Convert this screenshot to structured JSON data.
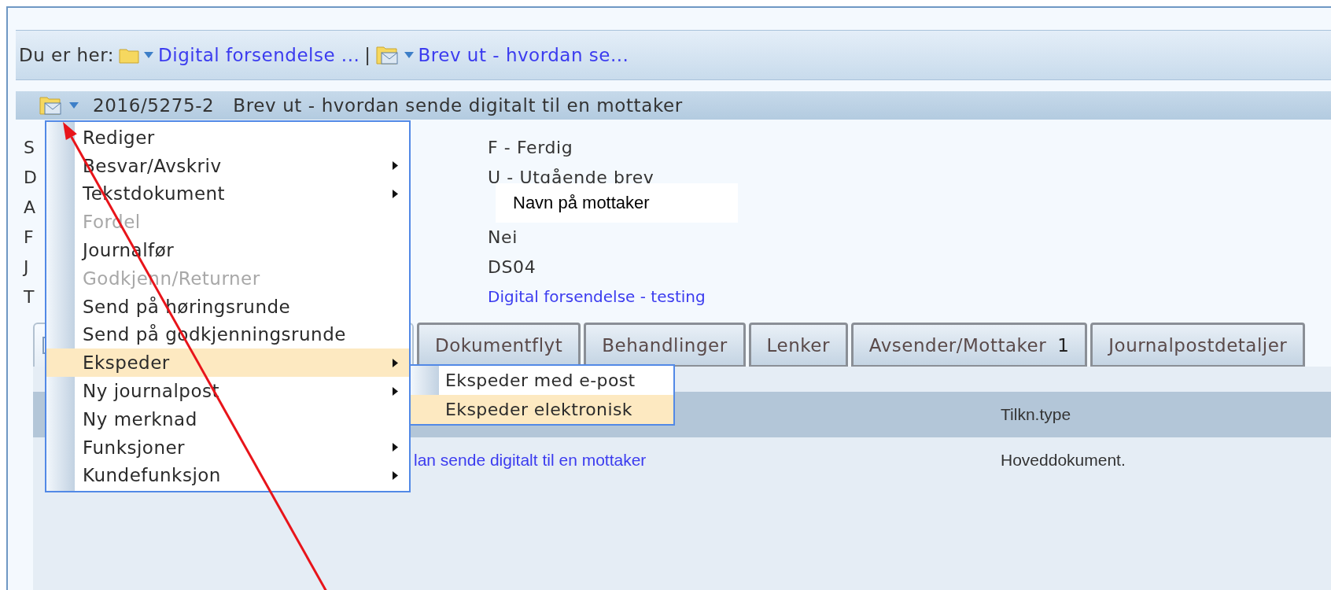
{
  "breadcrumb": {
    "label": "Du er her:",
    "separator": "|",
    "items": [
      {
        "text": "Digital forsendelse ..."
      },
      {
        "text": "Brev ut - hvordan se..."
      }
    ]
  },
  "header": {
    "number": "2016/5275-2",
    "title": "Brev ut - hvordan sende digitalt til en mottaker"
  },
  "fields": [
    {
      "label": "S",
      "value": "F - Ferdig",
      "kind": "text"
    },
    {
      "label": "D",
      "value": "U - Utgående brev",
      "kind": "text"
    },
    {
      "label": "A",
      "value": "Navn på mottaker",
      "kind": "note"
    },
    {
      "label": "F",
      "value": "Nei",
      "kind": "text"
    },
    {
      "label": "J",
      "value": "DS04",
      "kind": "text"
    },
    {
      "label": "T",
      "value": "Digital forsendelse - testing",
      "kind": "link"
    }
  ],
  "tabs": [
    {
      "label": "Dokumentflyt",
      "selected": false
    },
    {
      "label": "Behandlinger",
      "selected": false
    },
    {
      "label": "Lenker",
      "selected": false
    },
    {
      "label": "Avsender/Mottaker",
      "count": "1",
      "selected": false
    },
    {
      "label": "Journalpostdetaljer",
      "selected": false
    }
  ],
  "table": {
    "columns": [
      "Tilkn.type"
    ],
    "rows": [
      {
        "title": "lan sende digitalt til en mottaker",
        "type": "Hoveddokument."
      }
    ]
  },
  "context_menu": {
    "items": [
      {
        "label": "Rediger",
        "disabled": false,
        "submenu": false,
        "selected": false
      },
      {
        "label": "Besvar/Avskriv",
        "disabled": false,
        "submenu": true,
        "selected": false
      },
      {
        "label": "Tekstdokument",
        "disabled": false,
        "submenu": true,
        "selected": false
      },
      {
        "label": "Fordel",
        "disabled": true,
        "submenu": false,
        "selected": false
      },
      {
        "label": "Journalfør",
        "disabled": false,
        "submenu": false,
        "selected": false
      },
      {
        "label": "Godkjenn/Returner",
        "disabled": true,
        "submenu": false,
        "selected": false
      },
      {
        "label": "Send på høringsrunde",
        "disabled": false,
        "submenu": false,
        "selected": false
      },
      {
        "label": "Send på godkjenningsrunde",
        "disabled": false,
        "submenu": false,
        "selected": false
      },
      {
        "label": "Ekspeder",
        "disabled": false,
        "submenu": true,
        "selected": true
      },
      {
        "label": "Ny journalpost",
        "disabled": false,
        "submenu": true,
        "selected": false
      },
      {
        "label": "Ny merknad",
        "disabled": false,
        "submenu": false,
        "selected": false
      },
      {
        "label": "Funksjoner",
        "disabled": false,
        "submenu": true,
        "selected": false
      },
      {
        "label": "Kundefunksjon",
        "disabled": false,
        "submenu": true,
        "selected": false
      }
    ]
  },
  "submenu": {
    "items": [
      {
        "label": "Ekspeder med e-post",
        "selected": false
      },
      {
        "label": "Ekspeder elektronisk",
        "selected": true
      }
    ]
  }
}
